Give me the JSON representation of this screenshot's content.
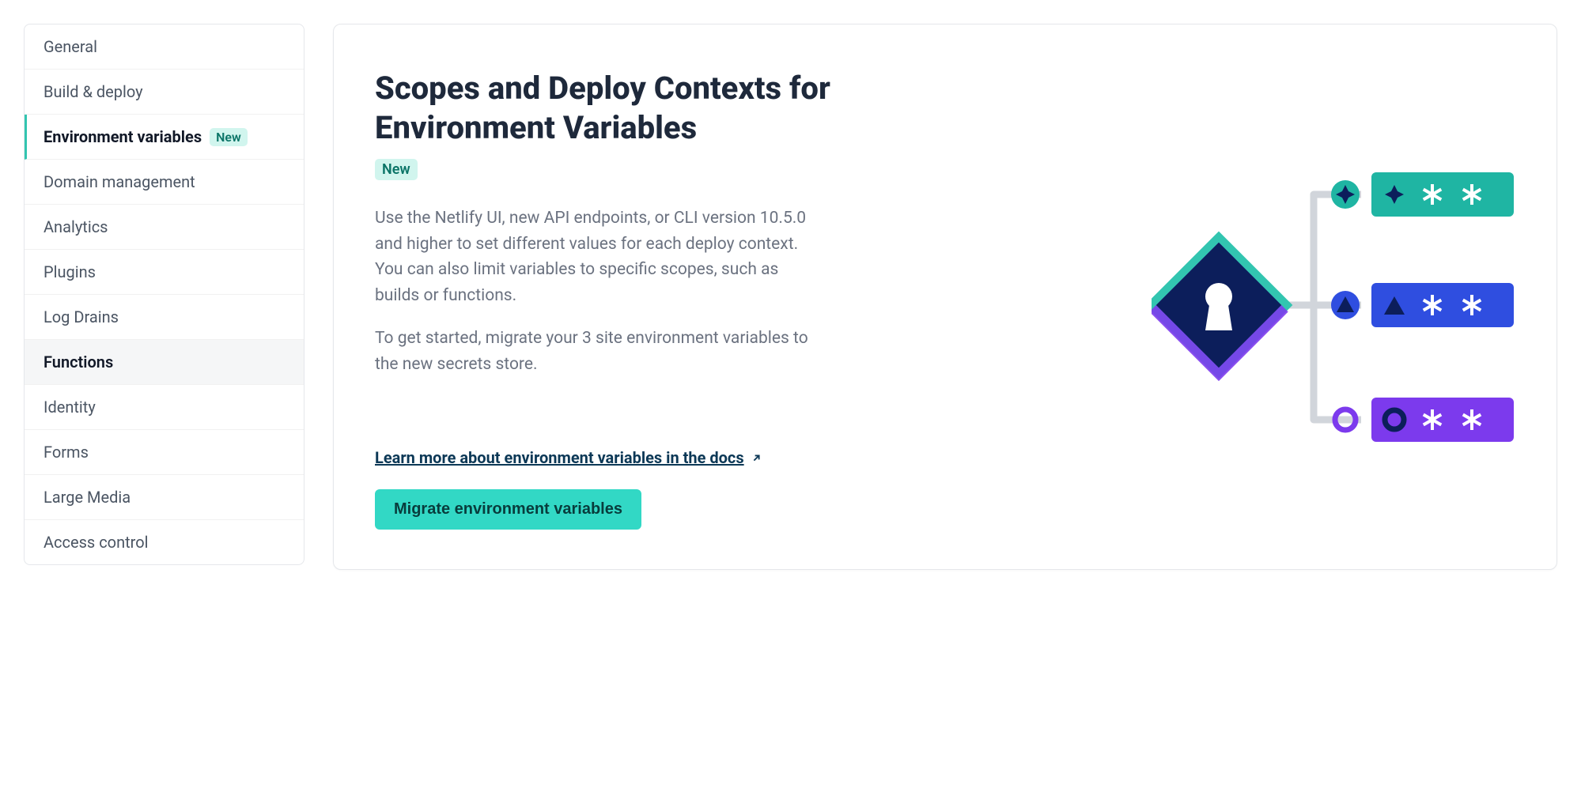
{
  "sidebar": {
    "items": [
      {
        "label": "General"
      },
      {
        "label": "Build & deploy"
      },
      {
        "label": "Environment variables",
        "badge": "New",
        "selected": true
      },
      {
        "label": "Domain management"
      },
      {
        "label": "Analytics"
      },
      {
        "label": "Plugins"
      },
      {
        "label": "Log Drains"
      },
      {
        "label": "Functions",
        "hovered": true
      },
      {
        "label": "Identity"
      },
      {
        "label": "Forms"
      },
      {
        "label": "Large Media"
      },
      {
        "label": "Access control"
      }
    ]
  },
  "main": {
    "title": "Scopes and Deploy Contexts for Environment Variables",
    "badge": "New",
    "description1": "Use the Netlify UI, new API endpoints, or CLI version 10.5.0 and higher to set different values for each deploy context. You can also limit variables to specific scopes, such as builds or functions.",
    "description2": "To get started, migrate your 3 site environment variables to the new secrets store.",
    "learn_link": "Learn more about environment variables in the docs",
    "migrate_button": "Migrate environment variables"
  },
  "colors": {
    "accent_teal": "#32d8c5",
    "badge_bg": "#d1f5ee",
    "navy": "#0c1e5b",
    "purple": "#7c3aed",
    "blue": "#2f4ee0"
  }
}
